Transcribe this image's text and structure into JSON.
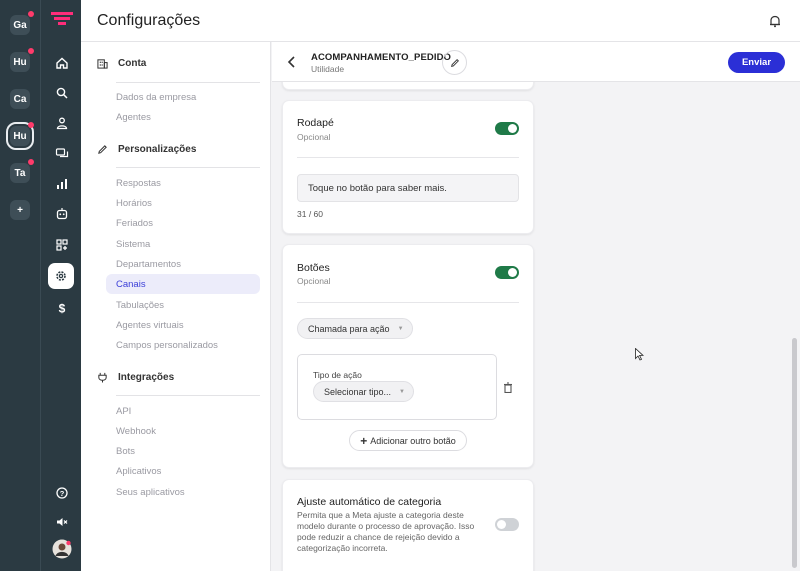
{
  "workspaces": [
    {
      "label": "Ga",
      "badge": true
    },
    {
      "label": "Hu",
      "badge": true
    },
    {
      "label": "Ca",
      "badge": false
    },
    {
      "label": "Hu",
      "badge": true,
      "active": true
    },
    {
      "label": "Ta",
      "badge": true
    }
  ],
  "add_workspace_label": "+",
  "nav_icons": [
    "home-icon",
    "search-icon",
    "contacts-icon",
    "chat-icon",
    "reports-icon",
    "bot-icon",
    "apps-icon",
    "settings-icon",
    "billing-icon"
  ],
  "header": {
    "title": "Configurações"
  },
  "sidebar": {
    "sections": [
      {
        "title": "Conta",
        "icon": "building-icon",
        "items": [
          "Dados da empresa",
          "Agentes"
        ]
      },
      {
        "title": "Personalizações",
        "icon": "pencil-icon",
        "items": [
          "Respostas",
          "Horários",
          "Feriados",
          "Sistema",
          "Departamentos",
          "Canais",
          "Tabulações",
          "Agentes virtuais",
          "Campos personalizados"
        ]
      },
      {
        "title": "Integrações",
        "icon": "plug-icon",
        "items": [
          "API",
          "Webhook",
          "Bots",
          "Aplicativos",
          "Seus aplicativos"
        ]
      }
    ],
    "active_item": "Canais"
  },
  "template": {
    "name": "ACOMPANHAMENTO_PEDIDO",
    "category": "Utilidade",
    "send_label": "Enviar"
  },
  "footer_card": {
    "title": "Rodapé",
    "subtitle": "Opcional",
    "enabled": true,
    "text": "Toque no botão para saber mais.",
    "counter": "31 / 60"
  },
  "buttons_card": {
    "title": "Botões",
    "subtitle": "Opcional",
    "enabled": true,
    "button_type": "Chamada para ação",
    "action_type_label": "Tipo de ação",
    "action_type_value": "Selecionar tipo...",
    "add_button_label": "Adicionar outro botão"
  },
  "category_card": {
    "title": "Ajuste automático de categoria",
    "description": "Permita que a Meta ajuste a categoria deste modelo durante o processo de aprovação. Isso pode reduzir a chance de rejeição devido a categorização incorreta.",
    "enabled": false
  },
  "colors": {
    "primary": "#2b2fd6",
    "toggle_on": "#1f7a48",
    "rail": "#2b3a42",
    "badge": "#ff3b6b"
  }
}
